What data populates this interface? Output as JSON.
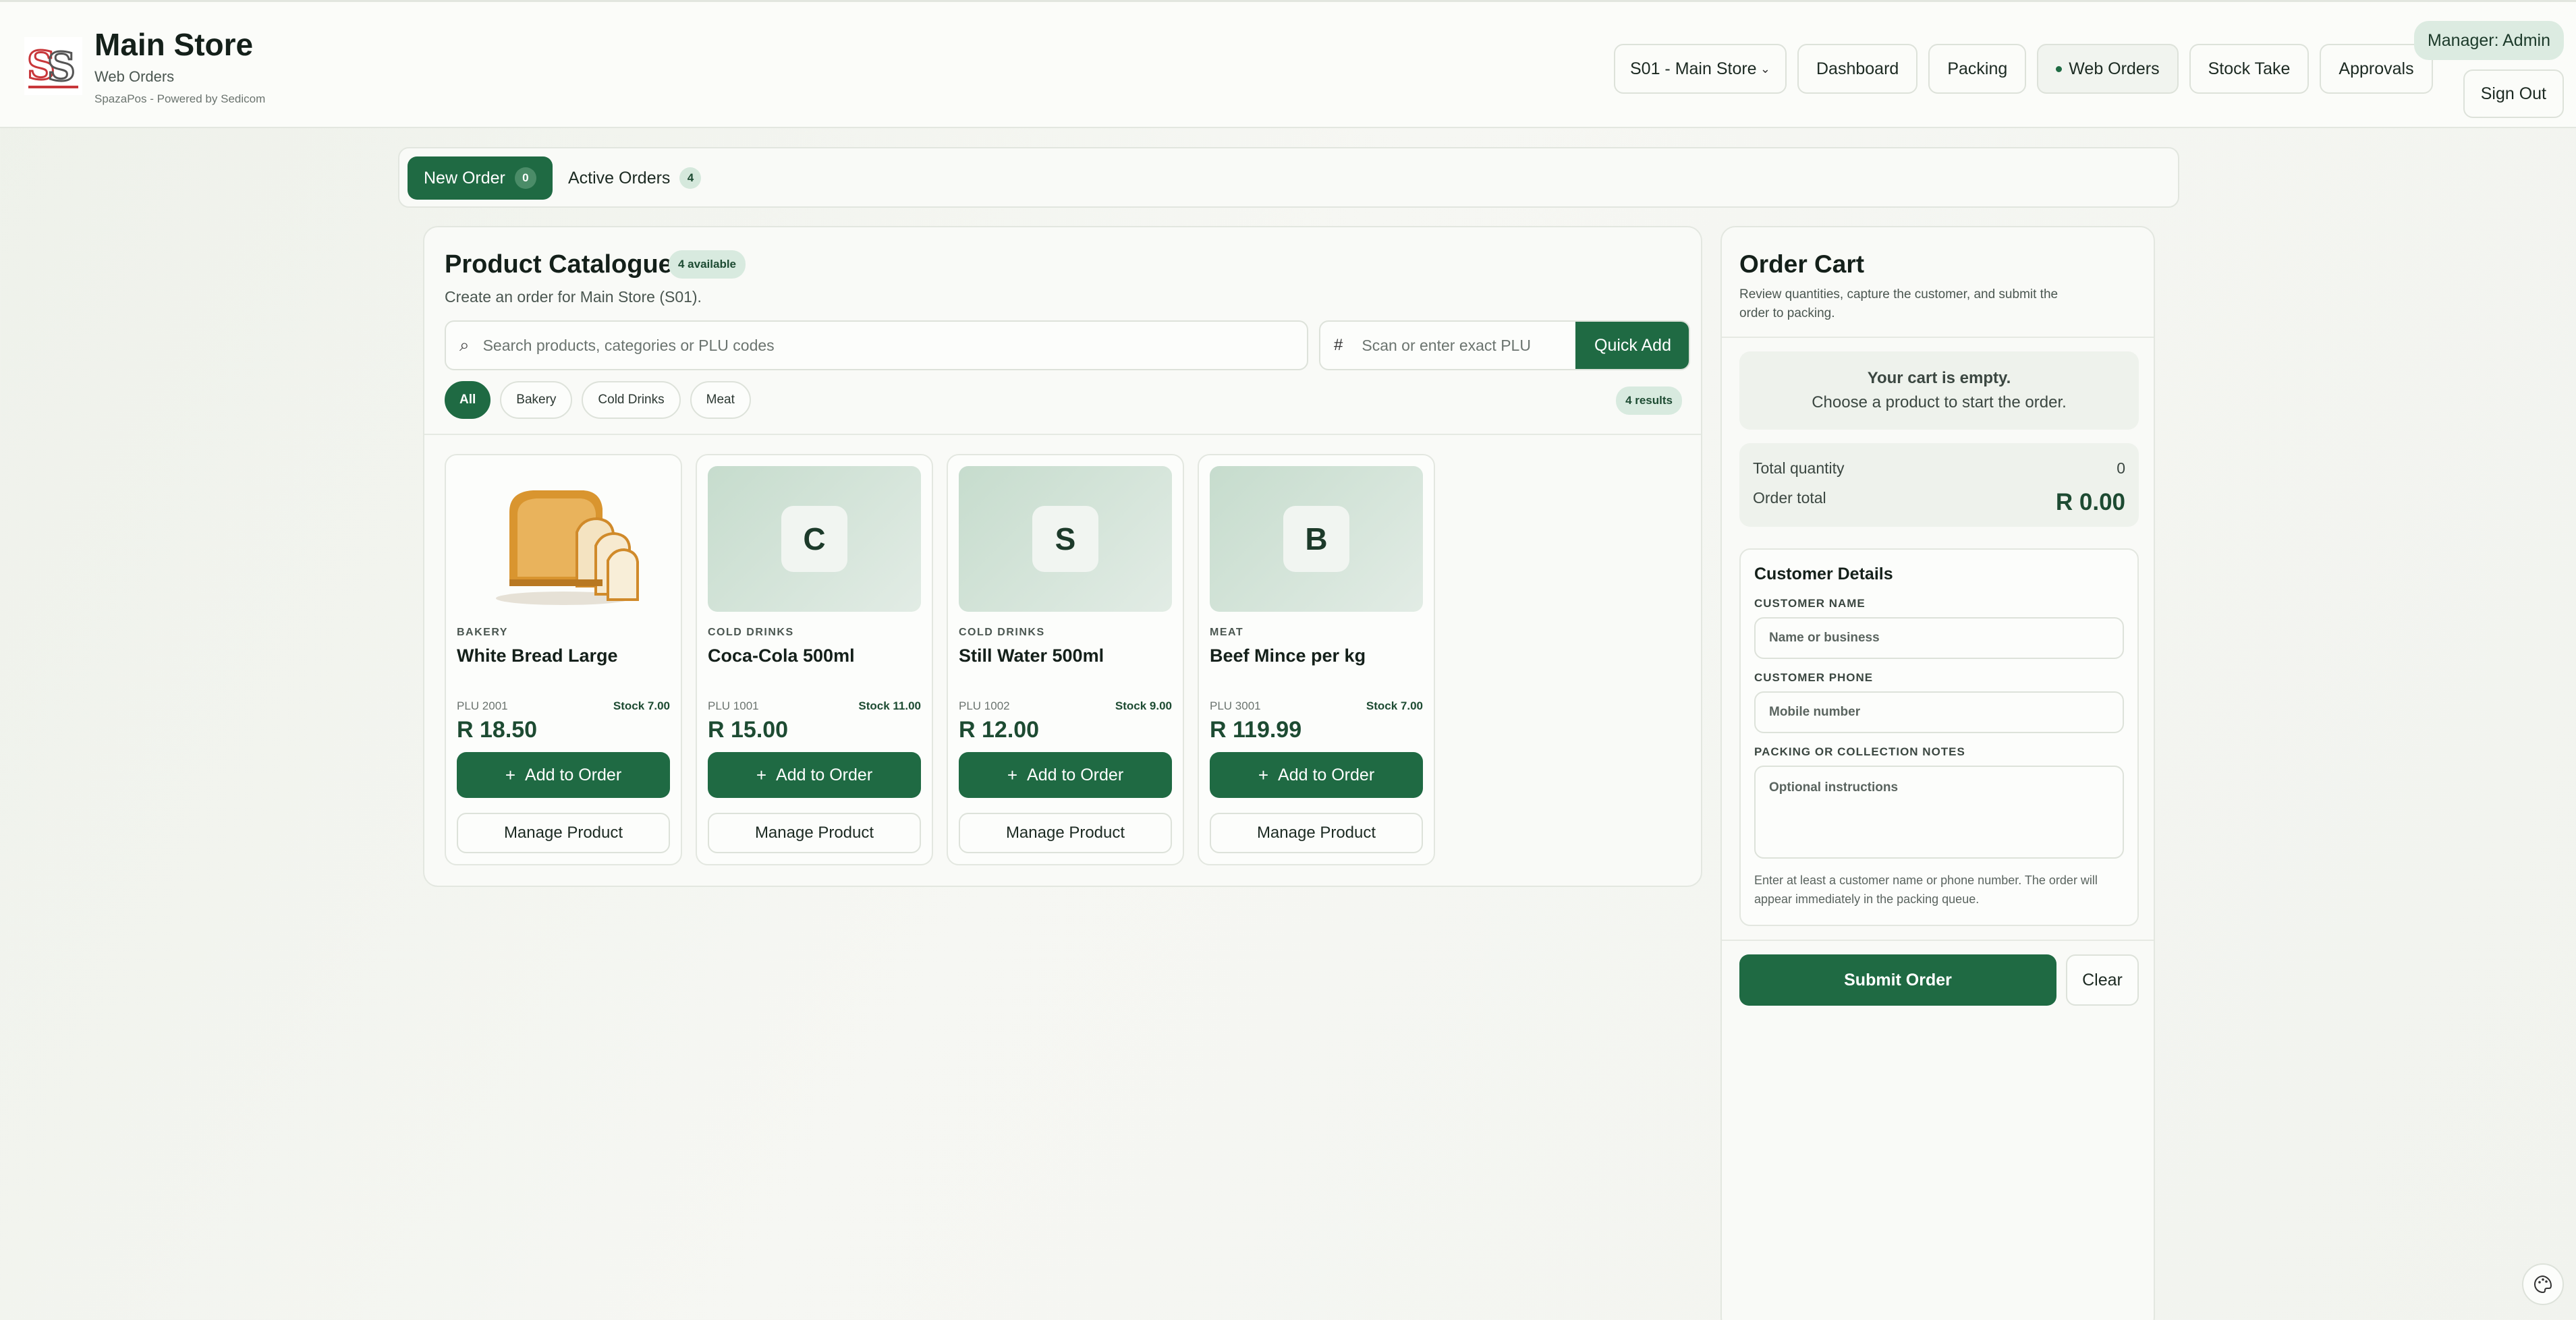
{
  "header": {
    "title": "Main Store",
    "subtitle": "Web Orders",
    "powered": "SpazaPos - Powered by Sedicom",
    "store_select": "S01 - Main Store",
    "nav": [
      "Dashboard",
      "Packing",
      "Web Orders",
      "Stock Take",
      "Approvals"
    ],
    "manager": "Manager: Admin",
    "signout": "Sign Out"
  },
  "tabs": {
    "new_label": "New Order",
    "new_count": "0",
    "active_label": "Active Orders",
    "active_count": "4"
  },
  "catalogue": {
    "title": "Product Catalogue",
    "available": "4 available",
    "description": "Create an order for Main Store (S01).",
    "search_placeholder": "Search products, categories or PLU codes",
    "plu_placeholder": "Scan or enter exact PLU",
    "quick_add": "Quick Add",
    "filters": [
      "All",
      "Bakery",
      "Cold Drinks",
      "Meat"
    ],
    "results": "4 results",
    "add_label": "Add to Order",
    "manage_label": "Manage Product",
    "products": [
      {
        "category": "Bakery",
        "name": "White Bread Large",
        "plu": "PLU 2001",
        "stock": "Stock 7.00",
        "price": "R 18.50",
        "image": "bread-photo"
      },
      {
        "category": "Cold Drinks",
        "name": "Coca-Cola 500ml",
        "plu": "PLU 1001",
        "stock": "Stock 11.00",
        "price": "R 15.00",
        "letter": "C"
      },
      {
        "category": "Cold Drinks",
        "name": "Still Water 500ml",
        "plu": "PLU 1002",
        "stock": "Stock 9.00",
        "price": "R 12.00",
        "letter": "S"
      },
      {
        "category": "Meat",
        "name": "Beef Mince per kg",
        "plu": "PLU 3001",
        "stock": "Stock 7.00",
        "price": "R 119.99",
        "letter": "B"
      }
    ]
  },
  "cart": {
    "title": "Order Cart",
    "description": "Review quantities, capture the customer, and submit the order to packing.",
    "empty_title": "Your cart is empty.",
    "empty_sub": "Choose a product to start the order.",
    "total_qty_label": "Total quantity",
    "total_qty": "0",
    "order_total_label": "Order total",
    "order_total": "R 0.00",
    "details_title": "Customer Details",
    "name_label": "Customer Name",
    "name_placeholder": "Name or business",
    "phone_label": "Customer Phone",
    "phone_placeholder": "Mobile number",
    "notes_label": "Packing or Collection Notes",
    "notes_placeholder": "Optional instructions",
    "help": "Enter at least a customer name or phone number. The order will appear immediately in the packing queue.",
    "submit": "Submit Order",
    "clear": "Clear"
  },
  "colors": {
    "brand": "#1f6a43",
    "badge": "#d8eadf"
  }
}
